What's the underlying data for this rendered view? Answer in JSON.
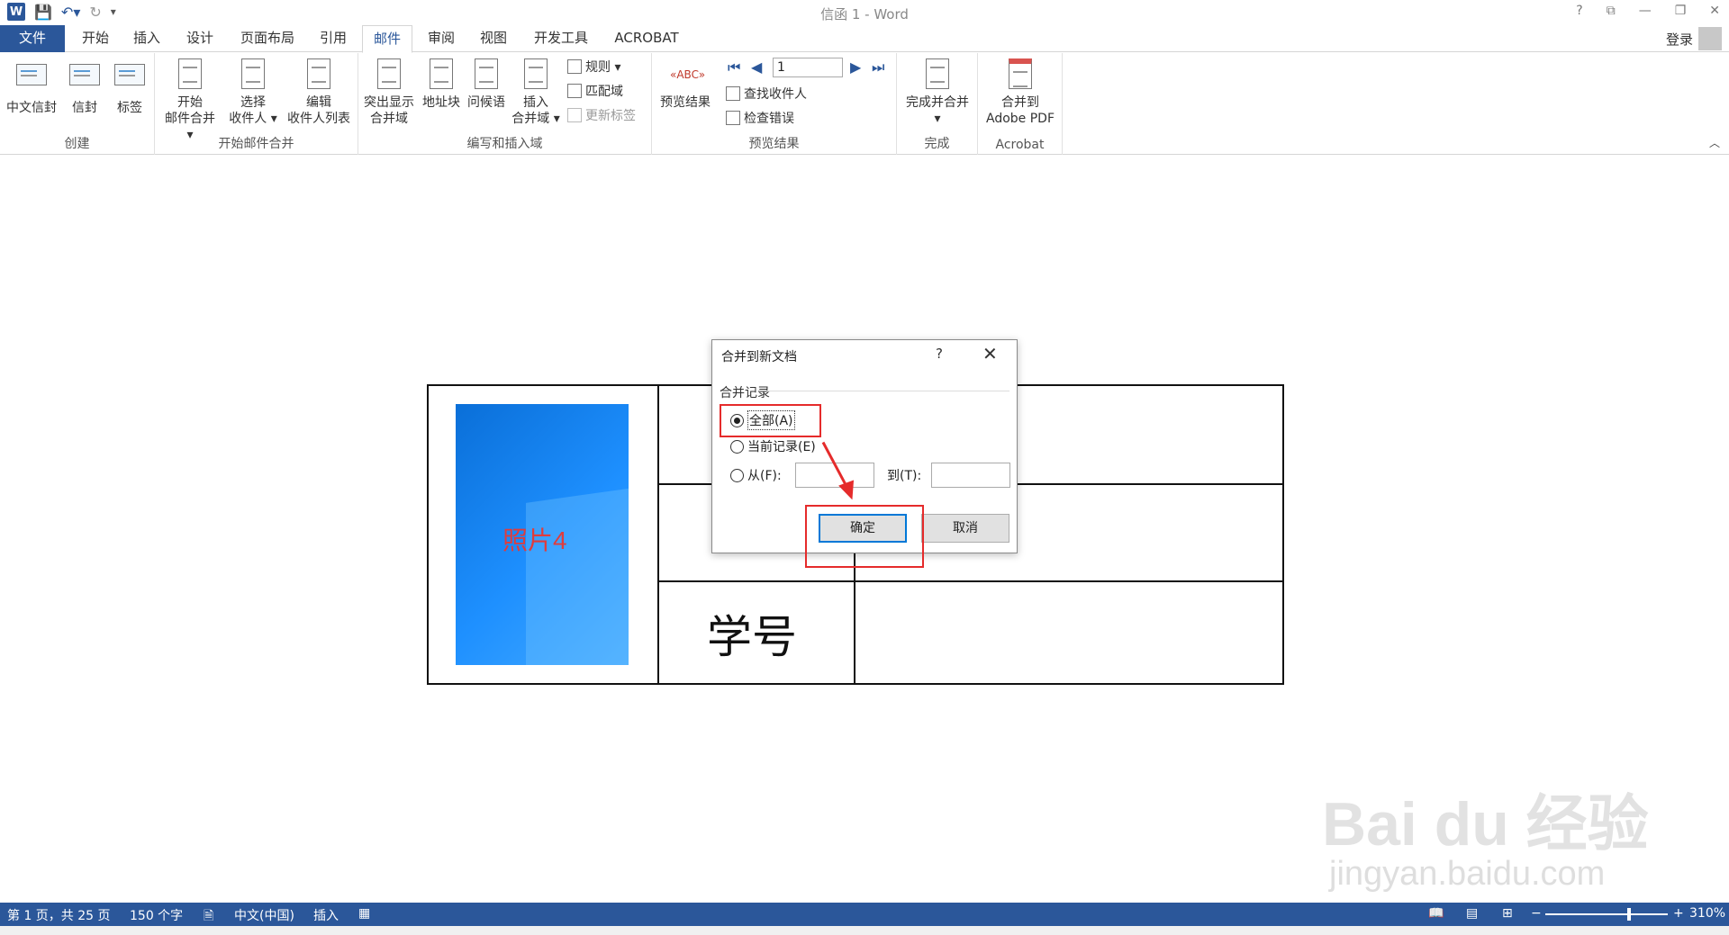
{
  "titlebar": {
    "title": "信函 1 - Word",
    "app_icon": "W",
    "qat_icons": [
      "save-icon",
      "undo-icon",
      "redo-icon",
      "customize-icon"
    ]
  },
  "tabs": {
    "file": "文件",
    "items": [
      "开始",
      "插入",
      "设计",
      "页面布局",
      "引用",
      "邮件",
      "审阅",
      "视图",
      "开发工具",
      "ACROBAT"
    ],
    "active": "邮件",
    "login": "登录"
  },
  "ribbon": {
    "groups": {
      "create": "创建",
      "start_merge": "开始邮件合并",
      "write_insert": "编写和插入域",
      "preview": "预览结果",
      "finish": "完成",
      "acrobat": "Acrobat"
    },
    "buttons": {
      "chinese_envelope": "中文信封",
      "envelope": "信封",
      "labels": "标签",
      "start_merge_1": "开始",
      "start_merge_2": "邮件合并 ▾",
      "select_recipients_1": "选择",
      "select_recipients_2": "收件人 ▾",
      "edit_recipients_1": "编辑",
      "edit_recipients_2": "收件人列表",
      "highlight_1": "突出显示",
      "highlight_2": "合并域",
      "address_block": "地址块",
      "greeting": "问候语",
      "insert_field_1": "插入",
      "insert_field_2": "合并域 ▾",
      "rules": "规则 ▾",
      "match_fields": "匹配域",
      "update_labels": "更新标签",
      "preview_results": "预览结果",
      "record_value": "1",
      "find_recipient": "查找收件人",
      "check_errors": "检查错误",
      "finish_merge_1": "完成并合并",
      "finish_merge_2": "▾",
      "merge_pdf_1": "合并到",
      "merge_pdf_2": "Adobe PDF"
    }
  },
  "document": {
    "photo_label": "照片4",
    "student_id_label": "学号"
  },
  "dialog": {
    "title": "合并到新文档",
    "help": "?",
    "close": "✕",
    "section": "合并记录",
    "options": {
      "all": "全部(A)",
      "current": "当前记录(E)",
      "from": "从(F):",
      "to": "到(T):"
    },
    "selected": "all",
    "ok": "确定",
    "cancel": "取消",
    "highlight_color": "#e52b2b"
  },
  "statusbar": {
    "page": "第 1 页，共 25 页",
    "words": "150 个字",
    "language": "中文(中国)",
    "mode": "插入",
    "zoom": "310%",
    "zoom_minus": "−",
    "zoom_plus": "+"
  },
  "watermark": {
    "line1": "Bai du 经验",
    "line2": "jingyan.baidu.com"
  },
  "colors": {
    "accent": "#2b579a"
  }
}
